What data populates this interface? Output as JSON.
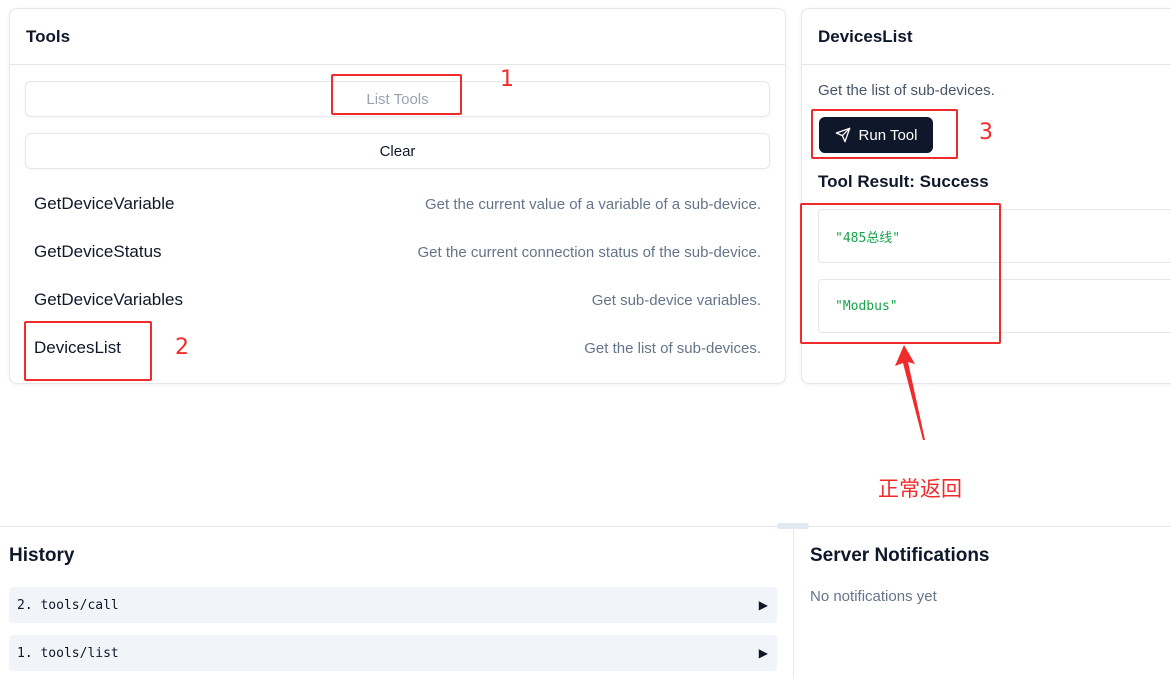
{
  "tools_panel": {
    "title": "Tools",
    "list_tools_label": "List Tools",
    "clear_label": "Clear",
    "tools": [
      {
        "name": "GetDeviceVariable",
        "description": "Get the current value of a variable of a sub-device."
      },
      {
        "name": "GetDeviceStatus",
        "description": "Get the current connection status of the sub-device."
      },
      {
        "name": "GetDeviceVariables",
        "description": "Get sub-device variables."
      },
      {
        "name": "DevicesList",
        "description": "Get the list of sub-devices."
      }
    ]
  },
  "tool_detail": {
    "title": "DevicesList",
    "description": "Get the list of sub-devices.",
    "run_label": "Run Tool",
    "run_icon": "send-icon",
    "result_title": "Tool Result: Success",
    "results": [
      "\"485总线\"",
      "\"Modbus\""
    ]
  },
  "annotations": {
    "step1": "1",
    "step2": "2",
    "step3": "3",
    "note": "正常返回",
    "color": "#ef2b2b"
  },
  "history": {
    "title": "History",
    "items": [
      "2. tools/call",
      "1. tools/list"
    ],
    "expand_icon": "▶"
  },
  "notifications": {
    "title": "Server Notifications",
    "empty_text": "No notifications yet"
  }
}
